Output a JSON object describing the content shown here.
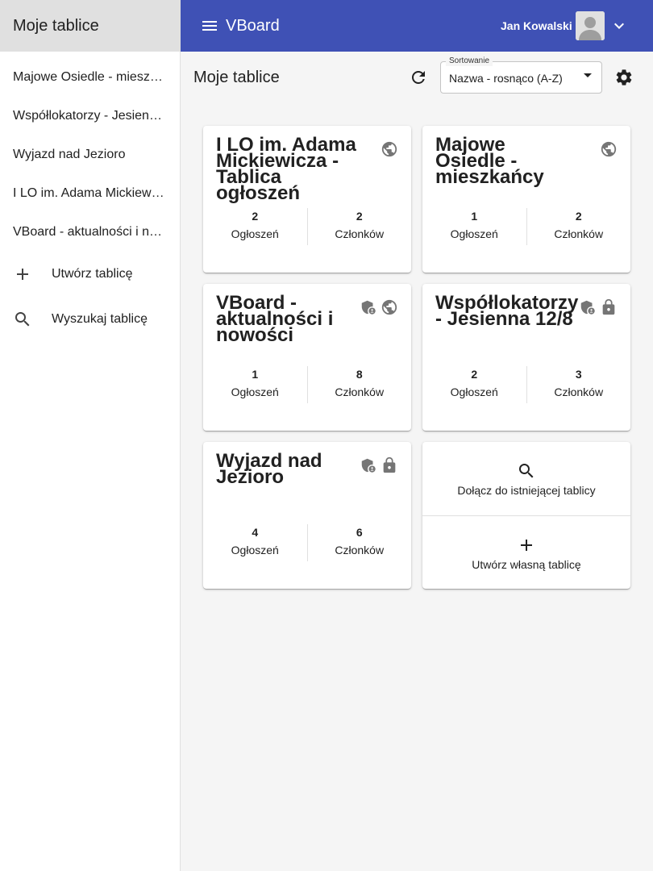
{
  "sidebar": {
    "title": "Moje tablice",
    "items": [
      {
        "label": "Majowe Osiedle - mieszkańcy"
      },
      {
        "label": "Współlokatorzy - Jesienna 12/8"
      },
      {
        "label": "Wyjazd nad Jezioro"
      },
      {
        "label": "I LO im. Adama Mickiewicza - Tablica ogłoszeń"
      },
      {
        "label": "VBoard - aktualności i nowości"
      }
    ],
    "create_label": "Utwórz tablicę",
    "search_label": "Wyszukaj tablicę"
  },
  "appbar": {
    "title": "VBoard",
    "user_name": "Jan Kowalski"
  },
  "toolbar": {
    "title": "Moje tablice",
    "sort_label": "Sortowanie",
    "sort_value": "Nazwa - rosnąco (A-Z)"
  },
  "cards": [
    {
      "title": "I LO im. Adama Mickiewicza - Tablica ogłoszeń",
      "posts": "2",
      "posts_label": "Ogłoszeń",
      "members": "2",
      "members_label": "Członków",
      "icons": [
        "public-icon"
      ]
    },
    {
      "title": "Majowe Osiedle - mieszkańcy",
      "posts": "1",
      "posts_label": "Ogłoszeń",
      "members": "2",
      "members_label": "Członków",
      "icons": [
        "public-icon"
      ]
    },
    {
      "title": "VBoard - aktualności i nowości",
      "posts": "1",
      "posts_label": "Ogłoszeń",
      "members": "8",
      "members_label": "Członków",
      "icons": [
        "admin-shield-icon",
        "public-icon"
      ]
    },
    {
      "title": "Współlokatorzy - Jesienna 12/8",
      "posts": "2",
      "posts_label": "Ogłoszeń",
      "members": "3",
      "members_label": "Członków",
      "icons": [
        "admin-shield-icon",
        "lock-icon"
      ]
    },
    {
      "title": "Wyjazd nad Jezioro",
      "posts": "4",
      "posts_label": "Ogłoszeń",
      "members": "6",
      "members_label": "Członków",
      "icons": [
        "admin-shield-icon",
        "lock-icon"
      ]
    }
  ],
  "actions": {
    "join_label": "Dołącz do istniejącej tablicy",
    "create_label": "Utwórz własną tablicę"
  },
  "colors": {
    "appbar": "#3f51b5",
    "sidebar_header": "#e0e0e0",
    "icon_gray": "#757575"
  }
}
